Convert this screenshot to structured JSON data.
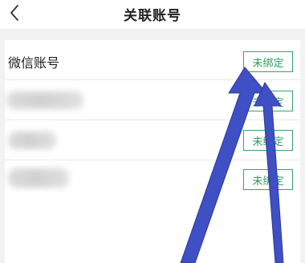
{
  "header": {
    "title": "关联账号",
    "back_icon": "chevron-left-icon"
  },
  "accounts": [
    {
      "label": "微信账号",
      "button_label": "未绑定",
      "label_visible": true
    },
    {
      "label": "",
      "button_label": "未绑定",
      "label_visible": false
    },
    {
      "label": "",
      "button_label": "未绑定",
      "label_visible": false
    },
    {
      "label": "",
      "button_label": "未绑定",
      "label_visible": false
    }
  ],
  "colors": {
    "accent_green": "#2f9a5e",
    "arrow_blue": "#3f4fc4",
    "background": "#f2f2f5"
  }
}
